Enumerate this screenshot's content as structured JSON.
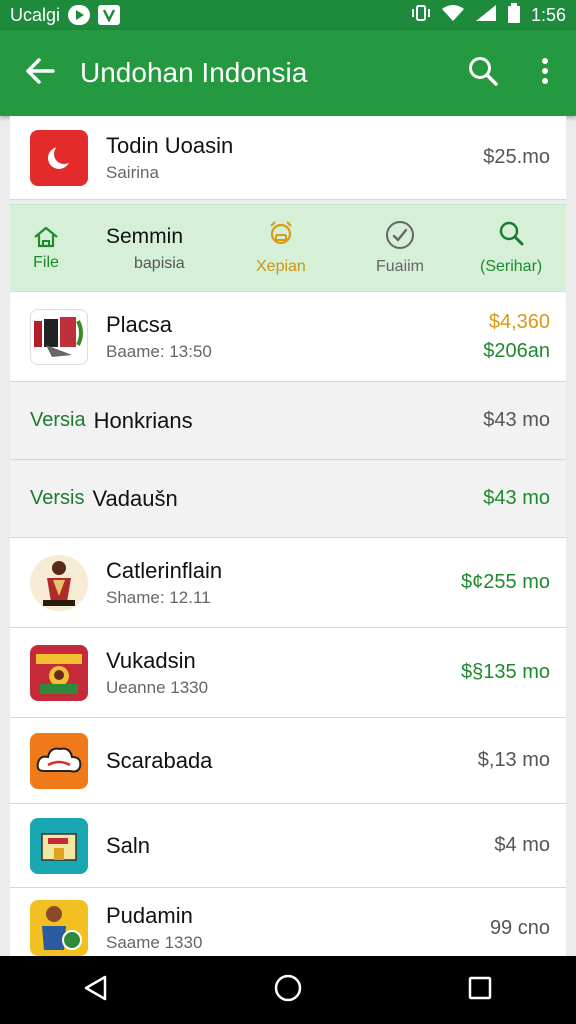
{
  "status_bar": {
    "carrier": "Ucalgi",
    "time": "1:56"
  },
  "app_bar": {
    "title": "Undohan Indonsia",
    "icons": [
      "back-arrow-icon",
      "search-icon",
      "more-vert-icon"
    ]
  },
  "top_item": {
    "name": "Todin Uoasin",
    "sub": "Sairina",
    "price": "$25.mo"
  },
  "tabs": {
    "file": "File",
    "title": "Semmin",
    "sub": "bapisia",
    "xepian": "Xepian",
    "fuaiim": "Fuaiim",
    "serihar": "(Serihar)"
  },
  "items": [
    {
      "name": "Placsa",
      "sub": "Baame: 13:50",
      "price": "$4,360",
      "price2": "$206an"
    },
    {
      "tag": "Versia",
      "name": "Honkrians",
      "price": "$43 mo"
    },
    {
      "tag": "Versis",
      "name": "Vadaušn",
      "price": "$43 mo"
    },
    {
      "name": "Catlerinflain",
      "sub": "Shame: 12.11",
      "price": "$¢255 mo"
    },
    {
      "name": "Vukadsin",
      "sub": "Ueanne 1330",
      "price": "$§135 mo"
    },
    {
      "name": "Scarabada",
      "price": "$,13 mo"
    },
    {
      "name": "Saln",
      "price": "$4 mo"
    },
    {
      "name": "Pudamin",
      "sub": "Saame 1330",
      "price": "99 cno"
    }
  ],
  "colors": {
    "status_bar": "#1e8a3c",
    "app_bar": "#24993f",
    "tab_strip": "#d6efd7",
    "accent_green": "#1e8a2e",
    "accent_orange": "#d99a16"
  }
}
